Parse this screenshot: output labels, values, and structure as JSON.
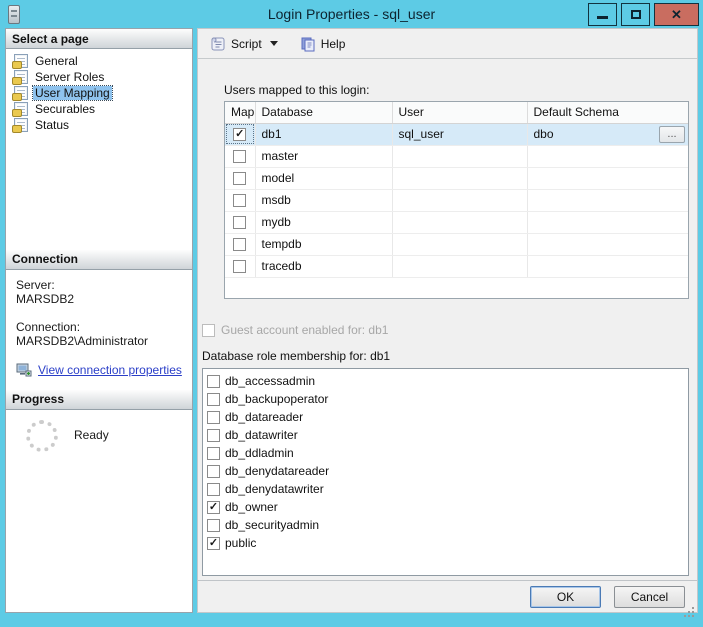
{
  "window": {
    "title": "Login Properties - sql_user"
  },
  "icons": {
    "close_glyph": "✕",
    "check_glyph": "✓",
    "browse_glyph": "..."
  },
  "colors": {
    "titlebar": "#5dcbe5",
    "close_button": "#c96d60",
    "row_selection": "#d6eaf8",
    "sidebar_selection": "#8fc3ee",
    "link": "#2b3fc8",
    "panel": "#f0f0f0"
  },
  "toolbar": {
    "script_label": "Script",
    "help_label": "Help"
  },
  "sidebar": {
    "select_page": {
      "header": "Select a page",
      "items": [
        {
          "label": "General",
          "selected": false
        },
        {
          "label": "Server Roles",
          "selected": false
        },
        {
          "label": "User Mapping",
          "selected": true
        },
        {
          "label": "Securables",
          "selected": false
        },
        {
          "label": "Status",
          "selected": false
        }
      ]
    },
    "connection": {
      "header": "Connection",
      "server_label": "Server:",
      "server_value": "MARSDB2",
      "connection_label": "Connection:",
      "connection_value": "MARSDB2\\Administrator",
      "link_label": "View connection properties"
    },
    "progress": {
      "header": "Progress",
      "status": "Ready"
    }
  },
  "main": {
    "users_table": {
      "caption": "Users mapped to this login:",
      "columns": [
        "Map",
        "Database",
        "User",
        "Default Schema"
      ],
      "rows": [
        {
          "checked": true,
          "database": "db1",
          "user": "sql_user",
          "schema": "dbo",
          "selected": true
        },
        {
          "checked": false,
          "database": "master",
          "user": "",
          "schema": "",
          "selected": false
        },
        {
          "checked": false,
          "database": "model",
          "user": "",
          "schema": "",
          "selected": false
        },
        {
          "checked": false,
          "database": "msdb",
          "user": "",
          "schema": "",
          "selected": false
        },
        {
          "checked": false,
          "database": "mydb",
          "user": "",
          "schema": "",
          "selected": false
        },
        {
          "checked": false,
          "database": "tempdb",
          "user": "",
          "schema": "",
          "selected": false
        },
        {
          "checked": false,
          "database": "tracedb",
          "user": "",
          "schema": "",
          "selected": false
        }
      ]
    },
    "guest": {
      "label": "Guest account enabled for: db1",
      "checked": false,
      "disabled": true
    },
    "roles": {
      "caption": "Database role membership for: db1",
      "items": [
        {
          "label": "db_accessadmin",
          "checked": false
        },
        {
          "label": "db_backupoperator",
          "checked": false
        },
        {
          "label": "db_datareader",
          "checked": false
        },
        {
          "label": "db_datawriter",
          "checked": false
        },
        {
          "label": "db_ddladmin",
          "checked": false
        },
        {
          "label": "db_denydatareader",
          "checked": false
        },
        {
          "label": "db_denydatawriter",
          "checked": false
        },
        {
          "label": "db_owner",
          "checked": true
        },
        {
          "label": "db_securityadmin",
          "checked": false
        },
        {
          "label": "public",
          "checked": true
        }
      ]
    }
  },
  "footer": {
    "ok_label": "OK",
    "cancel_label": "Cancel"
  }
}
